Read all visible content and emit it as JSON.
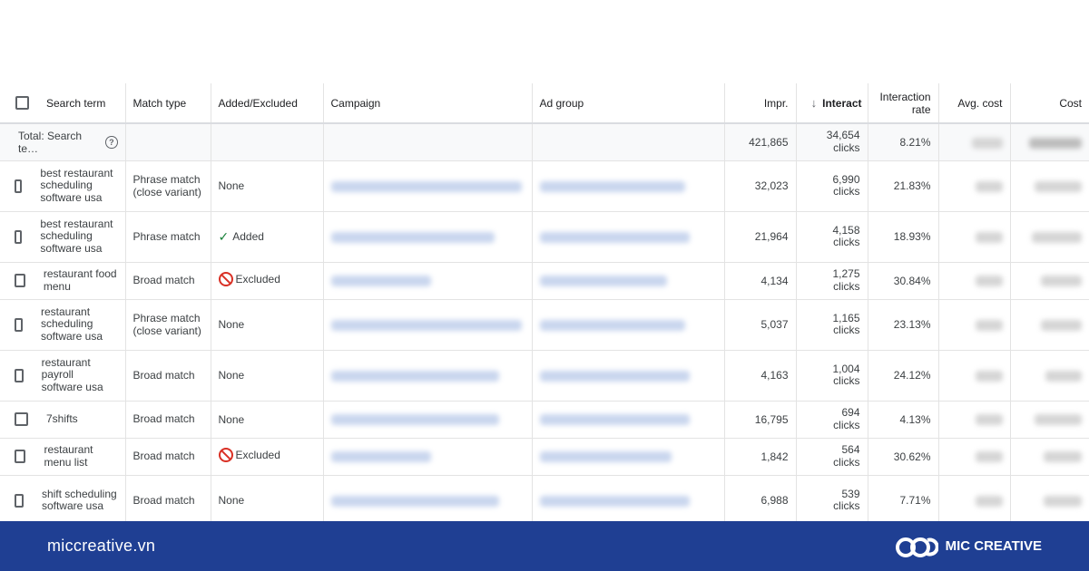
{
  "table": {
    "headers": {
      "search_term": "Search term",
      "match_type": "Match type",
      "added_excluded": "Added/Excluded",
      "campaign": "Campaign",
      "ad_group": "Ad group",
      "impr": "Impr.",
      "interactions": "Interact",
      "interaction_rate": "Interaction rate",
      "avg_cost": "Avg. cost",
      "cost": "Cost"
    },
    "total": {
      "label": "Total: Search te…",
      "impr": "421,865",
      "interactions": "34,654",
      "interactions_unit": "clicks",
      "rate": "8.21%"
    },
    "rows": [
      {
        "term": "best restaurant scheduling software usa",
        "match": "Phrase match (close variant)",
        "status": "None",
        "impr": "32,023",
        "interactions": "6,990",
        "unit": "clicks",
        "rate": "21.83%"
      },
      {
        "term": "best restaurant scheduling software usa",
        "match": "Phrase match",
        "status": "Added",
        "impr": "21,964",
        "interactions": "4,158",
        "unit": "clicks",
        "rate": "18.93%"
      },
      {
        "term": "restaurant food menu",
        "match": "Broad match",
        "status": "Excluded",
        "impr": "4,134",
        "interactions": "1,275",
        "unit": "clicks",
        "rate": "30.84%"
      },
      {
        "term": "restaurant scheduling software usa",
        "match": "Phrase match (close variant)",
        "status": "None",
        "impr": "5,037",
        "interactions": "1,165",
        "unit": "clicks",
        "rate": "23.13%"
      },
      {
        "term": "restaurant payroll software usa",
        "match": "Broad match",
        "status": "None",
        "impr": "4,163",
        "interactions": "1,004",
        "unit": "clicks",
        "rate": "24.12%"
      },
      {
        "term": "7shifts",
        "match": "Broad match",
        "status": "None",
        "impr": "16,795",
        "interactions": "694",
        "unit": "clicks",
        "rate": "4.13%"
      },
      {
        "term": "restaurant menu list",
        "match": "Broad match",
        "status": "Excluded",
        "impr": "1,842",
        "interactions": "564",
        "unit": "clicks",
        "rate": "30.62%"
      },
      {
        "term": "shift scheduling software usa",
        "match": "Broad match",
        "status": "None",
        "impr": "6,988",
        "interactions": "539",
        "unit": "clicks",
        "rate": "7.71%"
      }
    ]
  },
  "footer": {
    "site": "miccreative.vn",
    "brand": "MIC CREATIVE"
  },
  "colors": {
    "footer_bg": "#1f3f93",
    "added_green": "#188038",
    "excluded_red": "#d93025"
  },
  "icons": {
    "sort": "arrow-down-icon",
    "help": "help-circle-icon",
    "added": "check-icon",
    "excluded": "ban-icon"
  }
}
